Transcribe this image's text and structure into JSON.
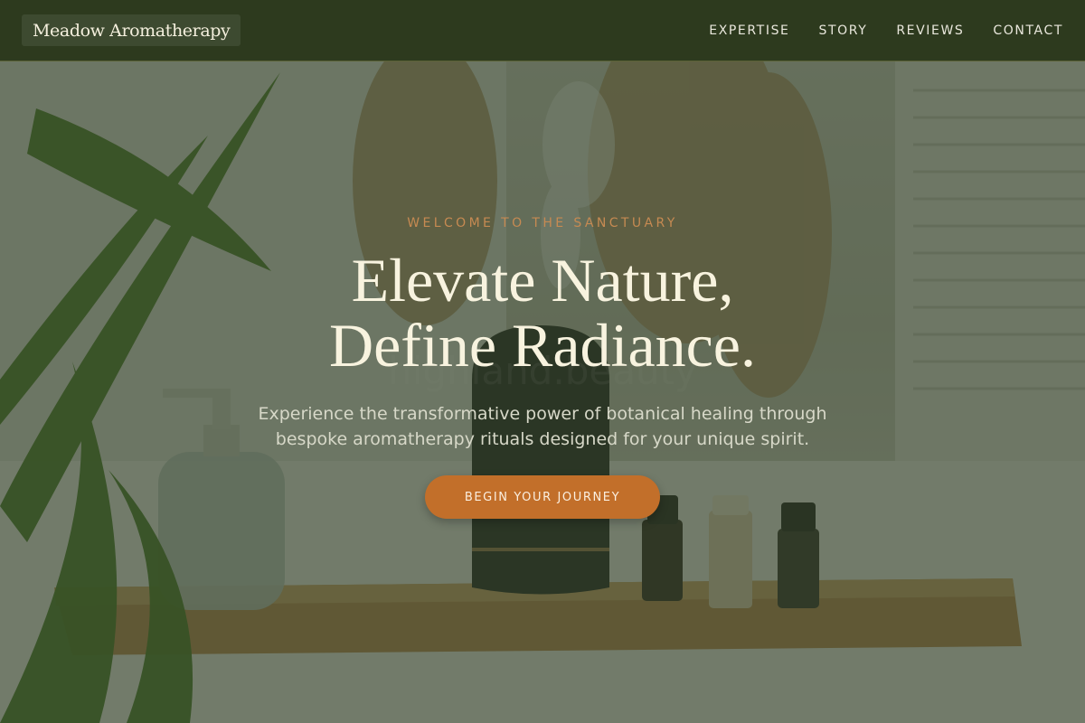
{
  "brand": {
    "name": "Meadow Aromatherapy"
  },
  "nav": {
    "items": [
      {
        "label": "EXPERTISE"
      },
      {
        "label": "STORY"
      },
      {
        "label": "REVIEWS"
      },
      {
        "label": "CONTACT"
      }
    ]
  },
  "hero": {
    "eyebrow": "WELCOME TO THE SANCTUARY",
    "headline_line1": "Elevate Nature,",
    "headline_line2": "Define Radiance.",
    "subtitle": "Experience the transformative power of botanical healing through bespoke aromatherapy rituals designed for your unique spirit.",
    "cta_label": "BEGIN YOUR JOURNEY"
  },
  "colors": {
    "header_bg": "#2d3a1e",
    "accent": "#c26f2a",
    "eyebrow": "#c68a52",
    "headline": "#f8f3df"
  }
}
